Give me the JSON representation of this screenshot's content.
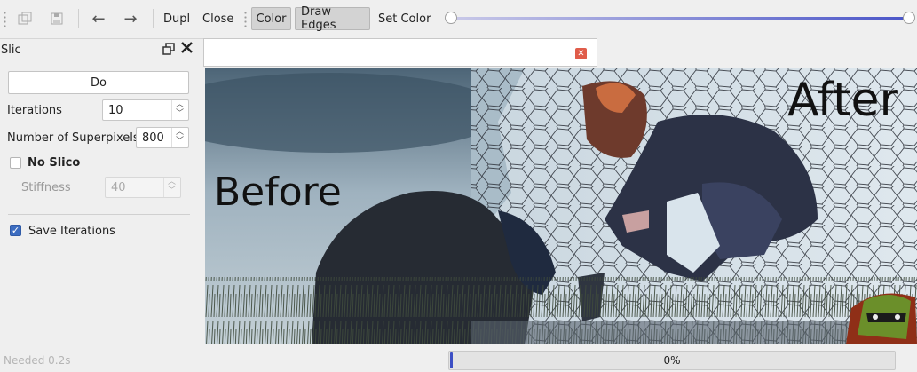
{
  "toolbar": {
    "icons": [
      "copy-icon",
      "save-icon"
    ],
    "back_glyph": "←",
    "forward_glyph": "→",
    "duplicate_label": "Dupl",
    "close_label": "Close",
    "color_label": "Color",
    "draw_edges_label": "Draw Edges",
    "set_color_label": "Set Color",
    "slider_level": 1.0
  },
  "panel": {
    "title": "Slic",
    "do_label": "Do",
    "iterations_label": "Iterations",
    "iterations_value": "10",
    "superpixels_label": "Number of Superpixels",
    "superpixels_value": "800",
    "no_slico_label": "No Slico",
    "no_slico_checked": false,
    "stiffness_label": "Stiffness",
    "stiffness_value": "40",
    "save_iterations_label": "Save Iterations",
    "save_iterations_checked": true
  },
  "viewer": {
    "before_label": "Before",
    "after_label": "After"
  },
  "status": {
    "needed_text": "Needed 0.2s",
    "progress_text": "0%",
    "progress_value": 0
  },
  "colors": {
    "accent": "#3c4fc4",
    "close_tab": "#e05c4a",
    "checkbox_on": "#3c6cc0"
  }
}
